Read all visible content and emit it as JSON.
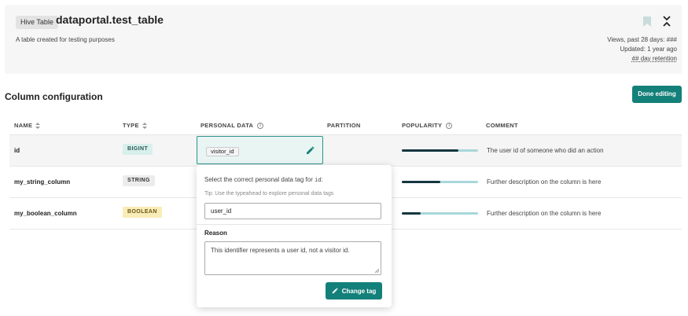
{
  "header": {
    "badge": "Hive Table",
    "title": "dataportal.test_table",
    "description": "A table created for testing purposes",
    "views": "Views, past 28 days: ###",
    "updated": "Updated: 1 year ago",
    "retention": "## day retention"
  },
  "section": {
    "title": "Column configuration",
    "done_label": "Done editing"
  },
  "columns_header": {
    "name": "NAME",
    "type": "TYPE",
    "personal_data": "PERSONAL DATA",
    "partition": "PARTITION",
    "popularity": "POPULARITY",
    "comment": "COMMENT"
  },
  "rows": [
    {
      "name": "id",
      "type": "BIGINT",
      "personal_tag": "visitor_id",
      "popularity": 0.74,
      "comment": "The user id of someone who did an action"
    },
    {
      "name": "my_string_column",
      "type": "STRING",
      "popularity": 0.5,
      "comment": "Further description on the column is here"
    },
    {
      "name": "my_boolean_column",
      "type": "BOOLEAN",
      "popularity": 0.25,
      "comment": "Further description on the column is here"
    }
  ],
  "popup": {
    "prompt": "Select the correct personal data tag for",
    "prompt_column": "id",
    "prompt_suffix": ":",
    "tip": "Tip: Use the typeahead to explore personal data tags",
    "input_value": "user_id",
    "reason_label": "Reason",
    "reason_value": "This identifier represents a user id, not a visitor id.",
    "change_label": "Change tag"
  },
  "colors": {
    "accent": "#14807a",
    "popularity_track": "#a8d7db",
    "popularity_fill": "#153640"
  }
}
